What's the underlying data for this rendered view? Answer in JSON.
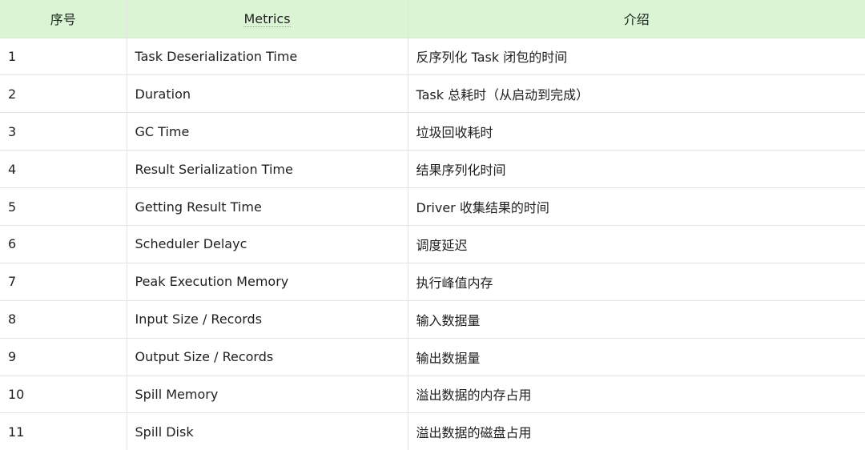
{
  "table": {
    "headers": [
      "序号",
      "Metrics",
      "介绍"
    ],
    "rows": [
      {
        "index": "1",
        "metric": "Task Deserialization Time",
        "description": "反序列化 Task 闭包的时间"
      },
      {
        "index": "2",
        "metric": "Duration",
        "description": "Task 总耗时（从启动到完成）"
      },
      {
        "index": "3",
        "metric": "GC Time",
        "description": "垃圾回收耗时"
      },
      {
        "index": "4",
        "metric": "Result Serialization Time",
        "description": "结果序列化时间"
      },
      {
        "index": "5",
        "metric": "Getting Result Time",
        "description": "Driver 收集结果的时间"
      },
      {
        "index": "6",
        "metric": "Scheduler Delayc",
        "description": "调度延迟"
      },
      {
        "index": "7",
        "metric": "Peak Execution Memory",
        "description": "执行峰值内存"
      },
      {
        "index": "8",
        "metric": "Input Size / Records",
        "description": "输入数据量"
      },
      {
        "index": "9",
        "metric": "Output Size / Records",
        "description": "输出数据量"
      },
      {
        "index": "10",
        "metric": "Spill Memory",
        "description": "溢出数据的内存占用"
      },
      {
        "index": "11",
        "metric": "Spill Disk",
        "description": "溢出数据的磁盘占用"
      }
    ]
  },
  "colors": {
    "header_background": "#d9f5d3",
    "grid_line": "#e3e3e3",
    "text": "#1f1f1f"
  }
}
